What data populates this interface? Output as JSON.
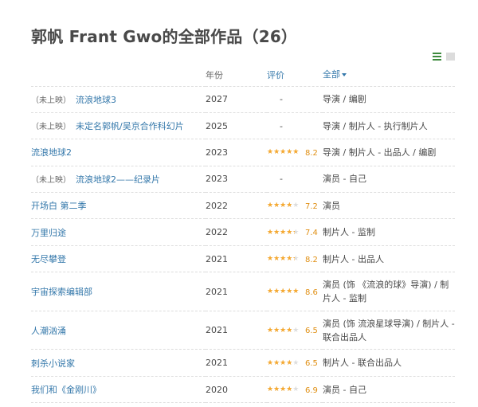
{
  "page": {
    "title": "郭帆 Frant Gwo的全部作品（26）"
  },
  "view_toggle": {
    "list_icon": "list-view-icon",
    "grid_icon": "grid-view-icon",
    "active_color": "#3d8a3d"
  },
  "table": {
    "headers": {
      "title": "",
      "year": "年份",
      "rating": "评价",
      "roles": "全部"
    },
    "rows": [
      {
        "unreleased": "（未上映）",
        "title": "流浪地球3",
        "year": "2027",
        "no_rating": "-",
        "rating": null,
        "score": "",
        "roles": "导演 / 编剧"
      },
      {
        "unreleased": "（未上映）",
        "title": "未定名郭帆/吴京合作科幻片",
        "year": "2025",
        "no_rating": "-",
        "rating": null,
        "score": "",
        "roles": "导演 / 制片人 - 执行制片人"
      },
      {
        "unreleased": "",
        "title": "流浪地球2",
        "year": "2023",
        "no_rating": "",
        "rating": 4.5,
        "score": "8.2",
        "roles": "导演 / 制片人 - 出品人 / 编剧"
      },
      {
        "unreleased": "（未上映）",
        "title": "流浪地球2——纪录片",
        "year": "2023",
        "no_rating": "-",
        "rating": null,
        "score": "",
        "roles": "演员 - 自己"
      },
      {
        "unreleased": "",
        "title": "开场白 第二季",
        "year": "2022",
        "no_rating": "",
        "rating": 3.5,
        "score": "7.2",
        "roles": "演员"
      },
      {
        "unreleased": "",
        "title": "万里归途",
        "year": "2022",
        "no_rating": "",
        "rating": 4.0,
        "score": "7.4",
        "roles": "制片人 - 监制"
      },
      {
        "unreleased": "",
        "title": "无尽攀登",
        "year": "2021",
        "no_rating": "",
        "rating": 4.0,
        "score": "8.2",
        "roles": "制片人 - 出品人"
      },
      {
        "unreleased": "",
        "title": "宇宙探索编辑部",
        "year": "2021",
        "no_rating": "",
        "rating": 4.5,
        "score": "8.6",
        "roles": "演员 (饰 《流浪的球》导演) / 制片人 - 监制"
      },
      {
        "unreleased": "",
        "title": "人潮汹涌",
        "year": "2021",
        "no_rating": "",
        "rating": 3.5,
        "score": "6.5",
        "roles": "演员 (饰 流浪星球导演) / 制片人 - 联合出品人"
      },
      {
        "unreleased": "",
        "title": "刺杀小说家",
        "year": "2021",
        "no_rating": "",
        "rating": 3.5,
        "score": "6.5",
        "roles": "制片人 - 联合出品人"
      },
      {
        "unreleased": "",
        "title": "我们和《金刚川》",
        "year": "2020",
        "no_rating": "",
        "rating": 3.5,
        "score": "6.9",
        "roles": "演员 - 自己"
      }
    ]
  },
  "colors": {
    "link": "#3377aa",
    "star": "#f6a930",
    "score": "#e09015"
  }
}
